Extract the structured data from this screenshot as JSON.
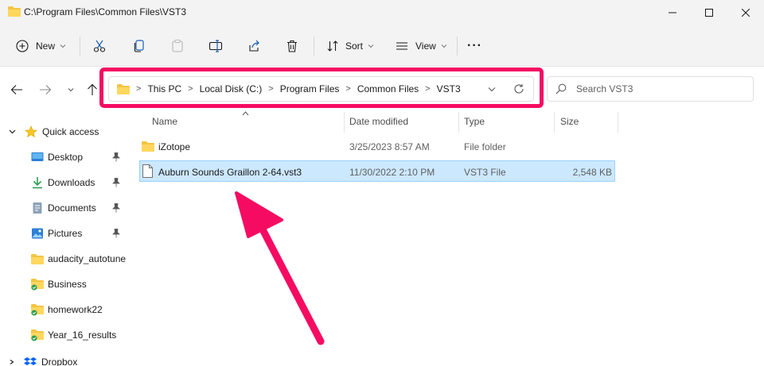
{
  "window": {
    "title": "C:\\Program Files\\Common Files\\VST3"
  },
  "toolbar": {
    "new_label": "New",
    "sort_label": "Sort",
    "view_label": "View",
    "more_label": "···"
  },
  "address": {
    "crumbs": [
      "This PC",
      "Local Disk (C:)",
      "Program Files",
      "Common Files",
      "VST3"
    ]
  },
  "search": {
    "placeholder": "Search VST3"
  },
  "sidebar": {
    "items": [
      {
        "label": "Quick access",
        "icon": "star-icon"
      },
      {
        "label": "Desktop",
        "icon": "desktop-icon"
      },
      {
        "label": "Downloads",
        "icon": "download-icon"
      },
      {
        "label": "Documents",
        "icon": "documents-icon"
      },
      {
        "label": "Pictures",
        "icon": "pictures-icon"
      },
      {
        "label": "audacity_autotune",
        "icon": "folder-icon"
      },
      {
        "label": "Business",
        "icon": "synced-folder-icon"
      },
      {
        "label": "homework22",
        "icon": "synced-folder-icon"
      },
      {
        "label": "Year_16_results",
        "icon": "synced-folder-icon"
      },
      {
        "label": "Dropbox",
        "icon": "dropbox-icon"
      }
    ]
  },
  "columns": {
    "name": "Name",
    "date": "Date modified",
    "type": "Type",
    "size": "Size"
  },
  "files": [
    {
      "name": "iZotope",
      "date": "3/25/2023 8:57 AM",
      "type": "File folder",
      "size": "",
      "icon": "folder-icon"
    },
    {
      "name": "Auburn Sounds Graillon 2-64.vst3",
      "date": "11/30/2022 2:10 PM",
      "type": "VST3 File",
      "size": "2,548 KB",
      "icon": "file-icon"
    }
  ],
  "colors": {
    "highlight": "#f50c62",
    "selection": "#cce8ff",
    "folder": "#f4c542"
  }
}
